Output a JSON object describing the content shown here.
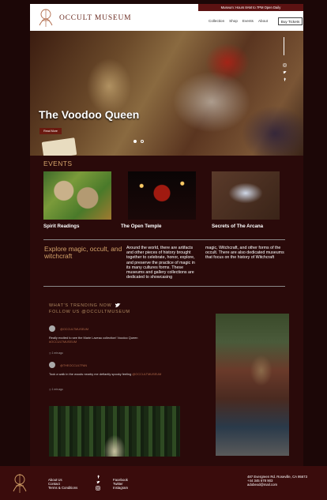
{
  "colors": {
    "accent": "#d4a36a",
    "brand_red": "#5c1212",
    "background": "#1c0707",
    "footer": "#3a0c0c"
  },
  "header": {
    "topbar": "Museum: Hours 8AM to 7PM Open Daily",
    "logo_text": "OCCULT MUSEUM",
    "nav": [
      "Collection",
      "Shop",
      "Events",
      "About"
    ],
    "buy": "Buy Tickets"
  },
  "hero": {
    "title": "The Voodoo Queen",
    "read_more": "Read More",
    "social_icons": [
      "instagram-icon",
      "twitter-icon",
      "facebook-icon"
    ]
  },
  "events": {
    "heading": "EVENTS",
    "items": [
      {
        "title": "Spirit Readings"
      },
      {
        "title": "The Open Temple"
      },
      {
        "title": "Secrets of The Arcana"
      }
    ]
  },
  "explore": {
    "heading": "Explore magic, occult, and witchcraft",
    "para1": "Around the world, there are artifacts and other pieces of history brought together to celebrate, honor, explore, and preserve the practice of magic in its many cultures forms. These museums and gallery collections are dedicated to showcasing",
    "para2": "magic, Witchcraft, and other forms of the occult. There are also dedicated museums that focus on the history of Witchcraft"
  },
  "trending": {
    "heading": "WHAT'S TRENDING NOW",
    "follow": "FOLLOW US @OCCULTMUSEUM",
    "tweets": [
      {
        "name": "@OCCULTMUSEUM",
        "text": "Really excited to see the Marie Laveau collection! Voodoo Queen",
        "tag": "#OCCULTMUSEUM",
        "time": "1 min ago"
      },
      {
        "name": "@THEOCCULTFAN",
        "text": "Took a walk in the woods nearby me defiantly spooky feeling",
        "tag": "@OCCULTMUSEUM",
        "time": "1 min ago"
      }
    ]
  },
  "footer": {
    "links": [
      "About Us",
      "Contact",
      "Terms & Conditions"
    ],
    "social": [
      "Facebook",
      "Twitter",
      "Instagram"
    ],
    "address": "487 Evergreen Rd. Roseville, CA 95673",
    "phone": "+44 345 678 903",
    "email": "adobexd@mail.com"
  }
}
